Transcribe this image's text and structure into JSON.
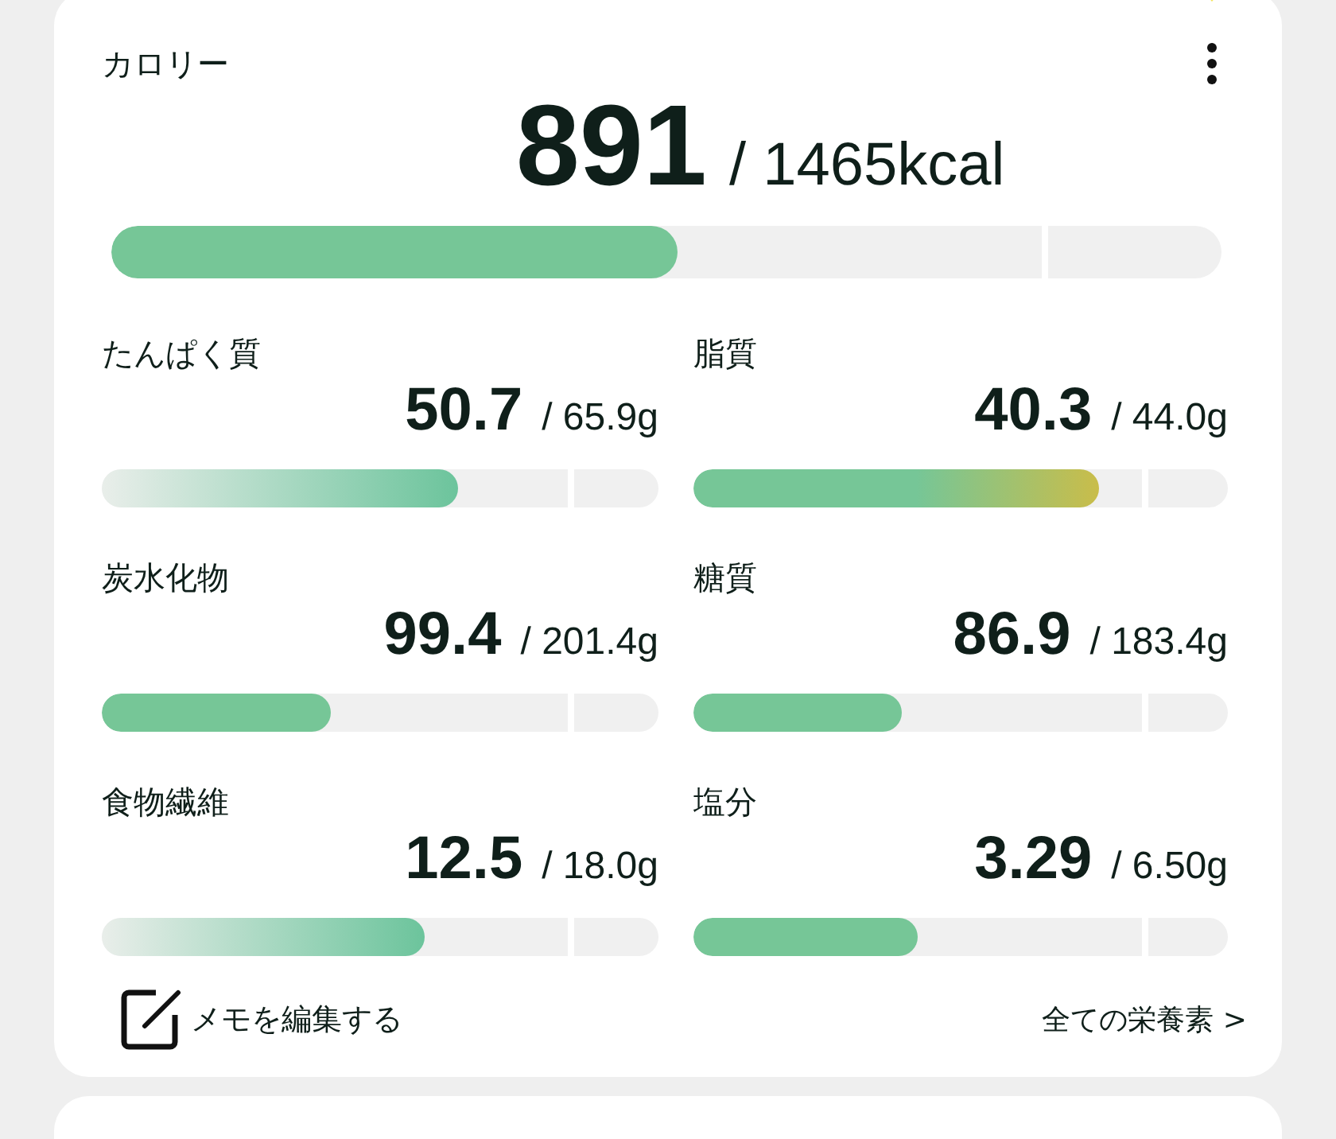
{
  "calorie": {
    "title": "カロリー",
    "value": "891",
    "target": "/ 1465kcal",
    "level": 0.51
  },
  "nutrients": [
    {
      "name": "たんぱく質",
      "value": "50.7",
      "target": "/ 65.9g",
      "level": 0.64,
      "kind": "fade"
    },
    {
      "name": "脂質",
      "value": "40.3",
      "target": "/ 44.0g",
      "level": 0.76,
      "kind": "warning"
    },
    {
      "name": "炭水化物",
      "value": "99.4",
      "target": "/ 201.4g",
      "level": 0.41,
      "kind": "solid"
    },
    {
      "name": "糖質",
      "value": "86.9",
      "target": "/ 183.4g",
      "level": 0.39,
      "kind": "solid"
    },
    {
      "name": "食物繊維",
      "value": "12.5",
      "target": "/ 18.0g",
      "level": 0.58,
      "kind": "fade"
    },
    {
      "name": "塩分",
      "value": "3.29",
      "target": "/ 6.50g",
      "level": 0.42,
      "kind": "solid"
    }
  ],
  "footer": {
    "memo": "メモを編集する",
    "all_nutrients": "全ての栄養素 >"
  }
}
